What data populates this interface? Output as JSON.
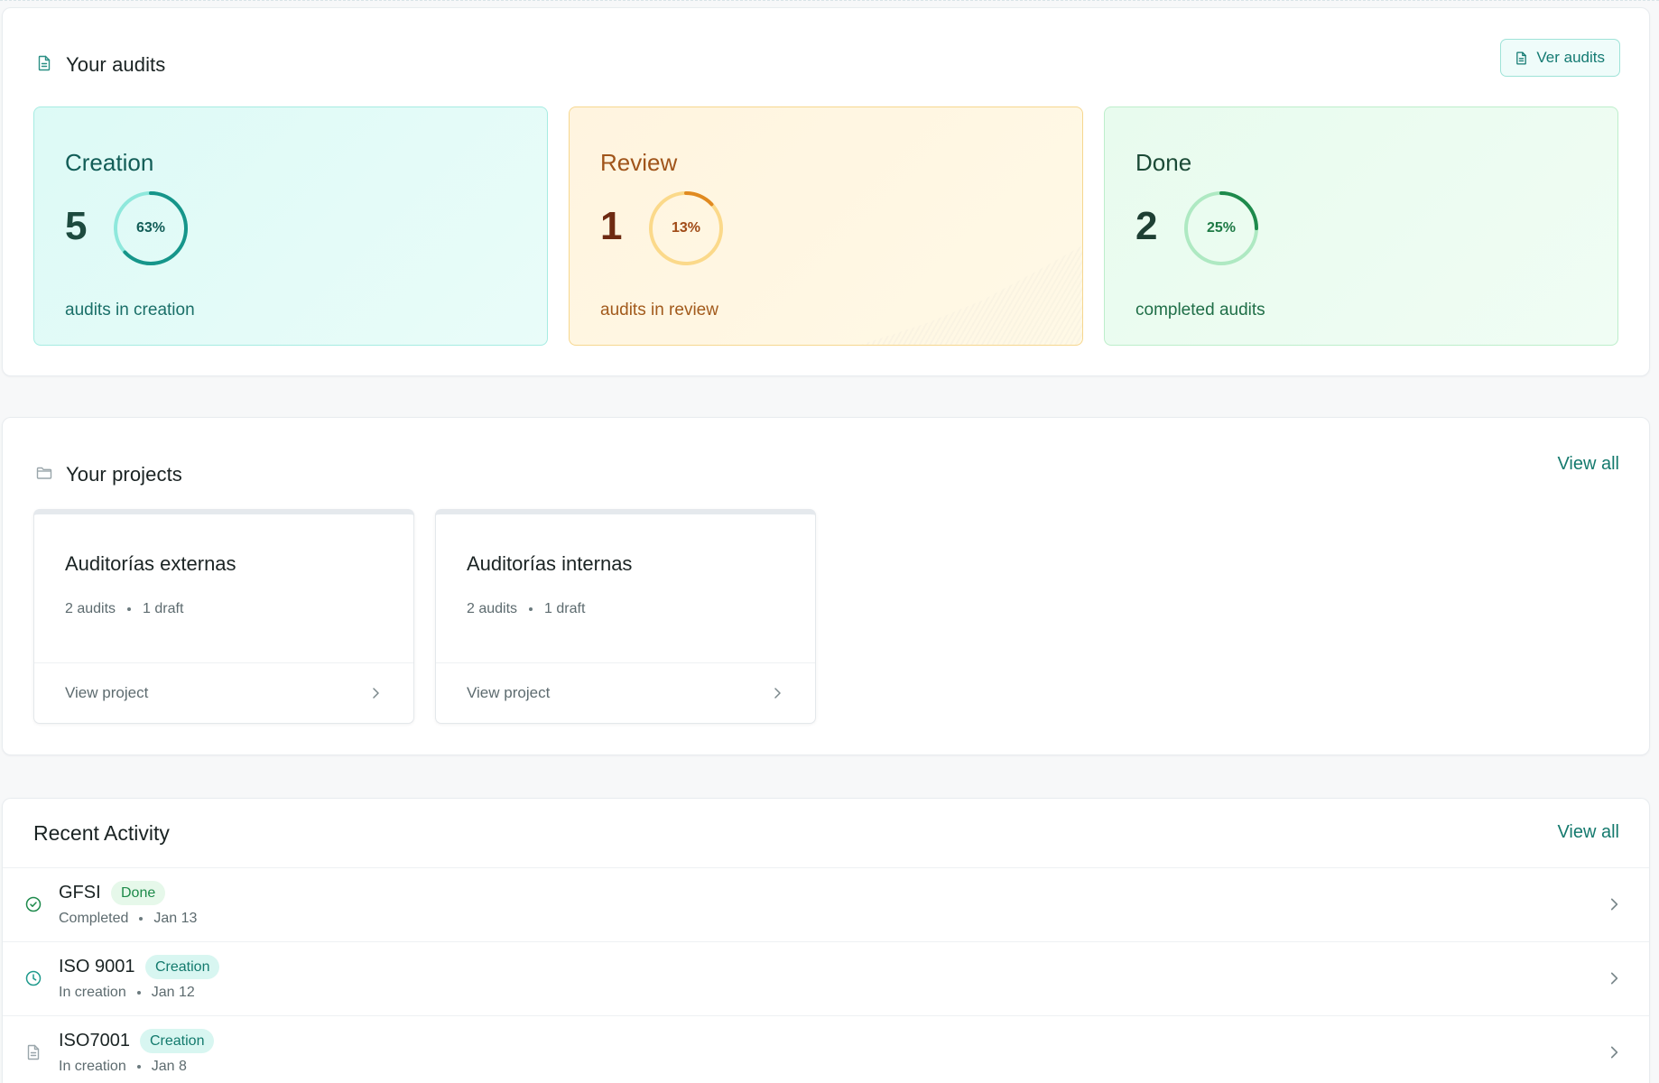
{
  "audits": {
    "title": "Your audits",
    "button_label": "Ver audits",
    "cards": [
      {
        "label": "Creation",
        "count": "5",
        "percent": 63,
        "percent_label": "63%",
        "subtitle": "audits in creation",
        "ring_color": "#16958a",
        "track_color": "#8ee8dc"
      },
      {
        "label": "Review",
        "count": "1",
        "percent": 13,
        "percent_label": "13%",
        "subtitle": "audits in review",
        "ring_color": "#e08a21",
        "track_color": "#fbd98a"
      },
      {
        "label": "Done",
        "count": "2",
        "percent": 25,
        "percent_label": "25%",
        "subtitle": "completed audits",
        "ring_color": "#1e8a4c",
        "track_color": "#aee9c2"
      }
    ]
  },
  "projects": {
    "title": "Your projects",
    "view_all": "View all",
    "items": [
      {
        "name": "Auditorías externas",
        "audits": "2 audits",
        "drafts": "1 draft",
        "link": "View project"
      },
      {
        "name": "Auditorías internas",
        "audits": "2 audits",
        "drafts": "1 draft",
        "link": "View project"
      }
    ]
  },
  "activity": {
    "title": "Recent Activity",
    "view_all": "View all",
    "items": [
      {
        "name": "GFSI",
        "badge": "Done",
        "status": "Completed",
        "date": "Jan 13",
        "icon": "check-circle-icon"
      },
      {
        "name": "ISO 9001",
        "badge": "Creation",
        "status": "In creation",
        "date": "Jan 12",
        "icon": "clock-icon"
      },
      {
        "name": "ISO7001",
        "badge": "Creation",
        "status": "In creation",
        "date": "Jan 8",
        "icon": "document-icon"
      }
    ]
  },
  "colors": {
    "accent": "#157a6e",
    "creation": "#16958a",
    "review": "#e08a21",
    "done": "#1e8a4c"
  }
}
